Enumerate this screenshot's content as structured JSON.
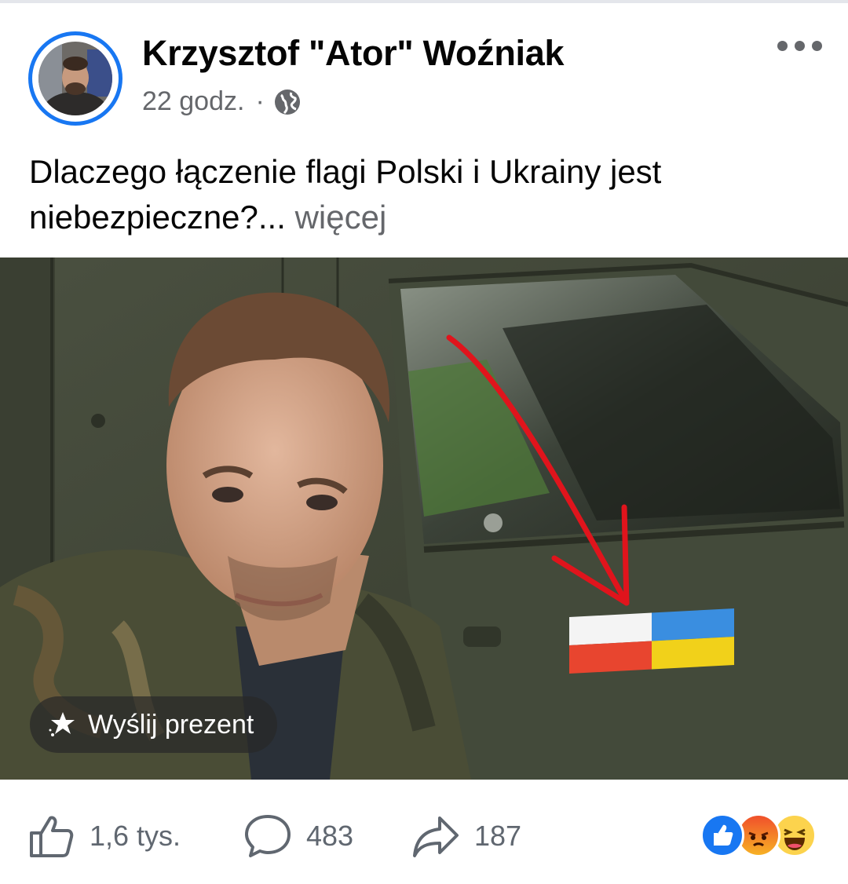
{
  "post": {
    "author_name": "Krzysztof \"Ator\" Woźniak",
    "time": "22 godz.",
    "separator": "·",
    "audience_icon": "globe-icon",
    "menu_icon": "more-icon",
    "text": "Dlaczego łączenie flagi Polski i Ukrainy jest niebezpieczne?",
    "ellipsis": "...",
    "more_label": "więcej"
  },
  "image": {
    "gift_button_label": "Wyślij prezent",
    "gift_icon": "gift-icon"
  },
  "actions": {
    "like_count": "1,6 tys.",
    "comment_count": "483",
    "share_count": "187",
    "like_icon": "thumbs-up-icon",
    "comment_icon": "comment-bubble-icon",
    "share_icon": "share-arrow-icon"
  },
  "reactions": [
    "like",
    "angry",
    "haha"
  ],
  "colors": {
    "accent": "#1877f2",
    "secondary_text": "#65676b",
    "poland_white": "#f4f4f4",
    "poland_red": "#e8452f",
    "ukraine_blue": "#3a8ee0",
    "ukraine_yellow": "#f1d11a",
    "arrow_red": "#e0141c"
  }
}
